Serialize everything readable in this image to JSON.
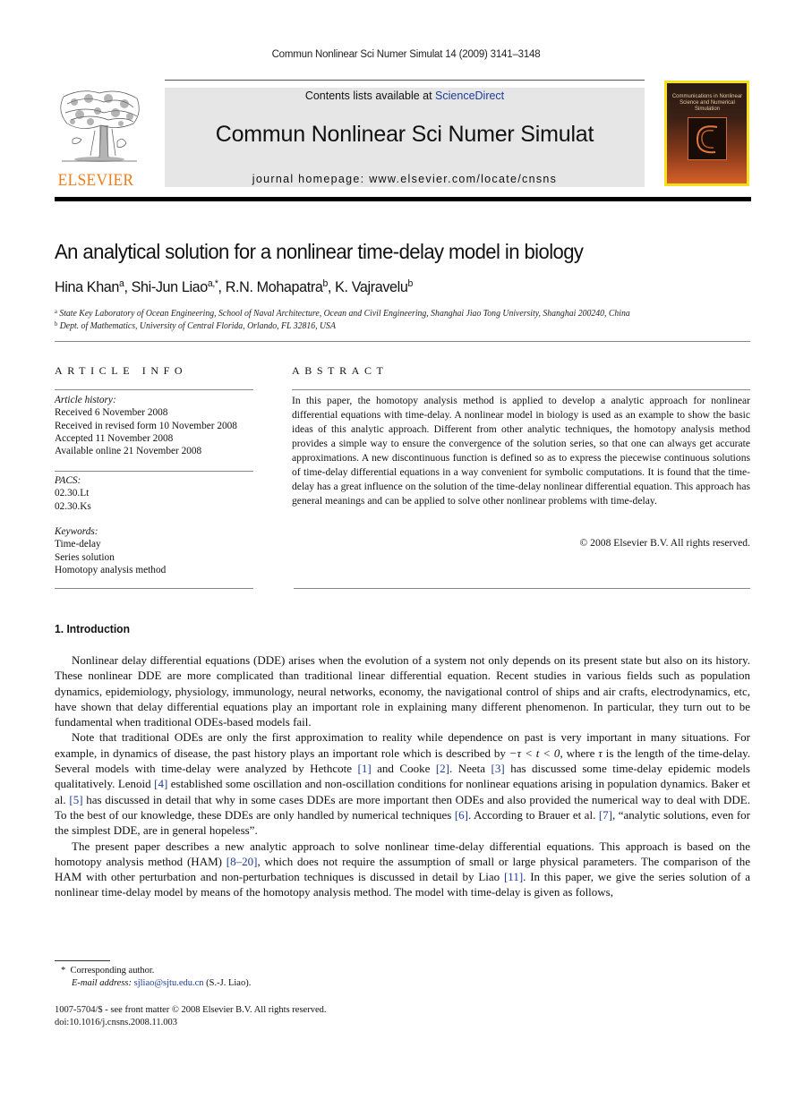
{
  "running_head": "Commun Nonlinear Sci Numer Simulat 14 (2009) 3141–3148",
  "masthead": {
    "publisher_logo_text": "ELSEVIER",
    "contents_prefix": "Contents lists available at ",
    "contents_link": "ScienceDirect",
    "journal_title": "Commun Nonlinear Sci Numer Simulat",
    "homepage": "journal homepage: www.elsevier.com/locate/cnsns",
    "cover_title": "Communications in Nonlinear Science and Numerical Simulation"
  },
  "article": {
    "title": "An analytical solution for a nonlinear time-delay model in biology",
    "authors": [
      {
        "name": "Hina Khan",
        "sup": "a",
        "sep": ", "
      },
      {
        "name": "Shi-Jun Liao",
        "sup": "a,*",
        "sep": ", "
      },
      {
        "name": "R.N. Mohapatra",
        "sup": "b",
        "sep": ", "
      },
      {
        "name": "K. Vajravelu",
        "sup": "b",
        "sep": ""
      }
    ],
    "affiliations": [
      {
        "mark": "a",
        "text": "State Key Laboratory of Ocean Engineering, School of Naval Architecture, Ocean and Civil Engineering, Shanghai Jiao Tong University, Shanghai 200240, China"
      },
      {
        "mark": "b",
        "text": "Dept. of Mathematics, University of Central Florida, Orlando, FL 32816, USA"
      }
    ]
  },
  "article_info": {
    "heading": "ARTICLE INFO",
    "history_label": "Article history:",
    "history": [
      "Received 6 November 2008",
      "Received in revised form 10 November 2008",
      "Accepted 11 November 2008",
      "Available online 21 November 2008"
    ],
    "pacs_label": "PACS:",
    "pacs": [
      "02.30.Lt",
      "02.30.Ks"
    ],
    "keywords_label": "Keywords:",
    "keywords": [
      "Time-delay",
      "Series solution",
      "Homotopy analysis method"
    ]
  },
  "abstract": {
    "heading": "ABSTRACT",
    "text": "In this paper, the homotopy analysis method is applied to develop a analytic approach for nonlinear differential equations with time-delay. A nonlinear model in biology is used as an example to show the basic ideas of this analytic approach. Different from other analytic techniques, the homotopy analysis method provides a simple way to ensure the convergence of the solution series, so that one can always get accurate approximations. A new discontinuous function is defined so as to express the piecewise continuous solutions of time-delay differential equations in a way convenient for symbolic computations. It is found that the time-delay has a great influence on the solution of the time-delay nonlinear differential equation. This approach has general meanings and can be applied to solve other nonlinear problems with time-delay.",
    "copyright": "© 2008 Elsevier B.V. All rights reserved."
  },
  "introduction": {
    "heading": "1.  Introduction",
    "p1": "Nonlinear delay differential equations (DDE) arises when the evolution of a system not only depends on its present state but also on its history. These nonlinear DDE are more complicated than traditional linear differential equation. Recent studies in various fields such as population dynamics, epidemiology, physiology, immunology, neural networks, economy, the navigational control of ships and air crafts, electrodynamics, etc, have shown that delay differential equations play an important role in explaining many different phenomenon. In particular, they turn out to be fundamental when traditional ODEs-based models fail.",
    "p2": {
      "s1": "Note that traditional ODEs are only the first approximation to reality while dependence on past is very important in many situations. For example, in dynamics of disease, the past history plays an important role which is described by ",
      "math1": "−τ < t < 0",
      "s2": ", where ",
      "tau": "τ",
      "s3": " is the length of the time-delay. Several models with time-delay were analyzed by Hethcote ",
      "r1": "[1]",
      "s4": " and Cooke ",
      "r2": "[2]",
      "s5": ". Neeta ",
      "r3": "[3]",
      "s6": " has discussed some time-delay epidemic models qualitatively. Lenoid ",
      "r4": "[4]",
      "s7": " established some oscillation and non-oscillation conditions for nonlinear equations arising in population dynamics. Baker et al. ",
      "r5": "[5]",
      "s8": " has discussed in detail that why in some cases DDEs are more important then ODEs and also provided the numerical way to deal with DDE. To the best of our knowledge, these DDEs are only handled by numerical techniques ",
      "r6": "[6]",
      "s9": ". According to Brauer et al. ",
      "r7": "[7]",
      "s10": ", “analytic solutions, even for the simplest DDE, are in general hopeless”."
    },
    "p3": {
      "s1": "The present paper describes a new analytic approach to solve nonlinear time-delay differential equations. This approach is based on the homotopy analysis method (HAM) ",
      "r1": "[8–20]",
      "s2": ", which does not require the assumption of small or large physical parameters. The comparison of the HAM with other perturbation and non-perturbation techniques is discussed in detail by Liao ",
      "r2": "[11]",
      "s3": ". In this paper, we give the series solution of a nonlinear time-delay model by means of the homotopy analysis method. The model with time-delay is given as follows,"
    }
  },
  "footnote": {
    "mark": "*",
    "corresponding": "Corresponding author.",
    "email_label": "E-mail address: ",
    "email": "sjliao@sjtu.edu.cn",
    "email_suffix": " (S.-J. Liao)."
  },
  "bottom": {
    "issn": "1007-5704/$ - see front matter © 2008 Elsevier B.V. All rights reserved.",
    "doi": "doi:10.1016/j.cnsns.2008.11.003"
  }
}
